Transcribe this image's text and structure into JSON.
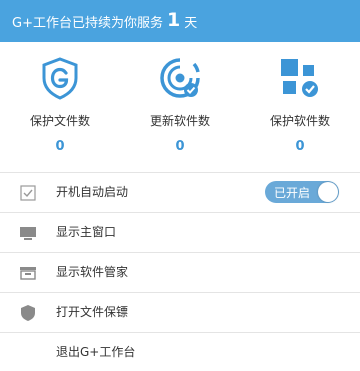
{
  "header": {
    "prefix": "G+工作台已持续为你服务",
    "days": "1",
    "suffix": "天"
  },
  "stats": [
    {
      "label": "保护文件数",
      "value": "0",
      "icon": "shield-g-icon"
    },
    {
      "label": "更新软件数",
      "value": "0",
      "icon": "update-disc-icon"
    },
    {
      "label": "保护软件数",
      "value": "0",
      "icon": "app-tiles-icon"
    }
  ],
  "menu": {
    "autostart": {
      "label": "开机自动启动",
      "toggle_label": "已开启",
      "enabled": true
    },
    "main_window": {
      "label": "显示主窗口"
    },
    "software_manager": {
      "label": "显示软件管家"
    },
    "file_protect": {
      "label": "打开文件保镖"
    },
    "exit": {
      "label": "退出G+工作台"
    }
  },
  "colors": {
    "header_bg": "#4aa3df",
    "accent": "#3c95d6",
    "toggle_bg": "#6aa9d8"
  }
}
